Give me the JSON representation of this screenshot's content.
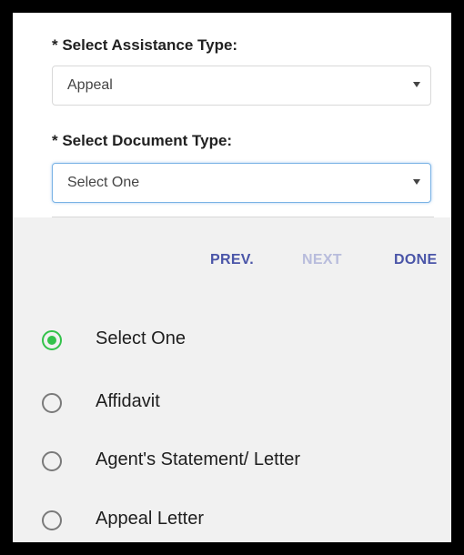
{
  "form": {
    "assistance_label": "* Select Assistance Type:",
    "assistance_value": "Appeal",
    "document_label": "* Select Document Type:",
    "document_value": "Select One"
  },
  "picker": {
    "prev_label": "PREV.",
    "next_label": "NEXT",
    "done_label": "DONE",
    "options": [
      {
        "label": "Select One",
        "selected": true
      },
      {
        "label": "Affidavit",
        "selected": false
      },
      {
        "label": "Agent's Statement/ Letter",
        "selected": false
      },
      {
        "label": "Appeal Letter",
        "selected": false
      }
    ]
  },
  "colors": {
    "accent": "#4a55a8",
    "accent_disabled": "#b8bcdc",
    "radio_selected": "#33c24a",
    "focus_border": "#7ab3e5"
  }
}
